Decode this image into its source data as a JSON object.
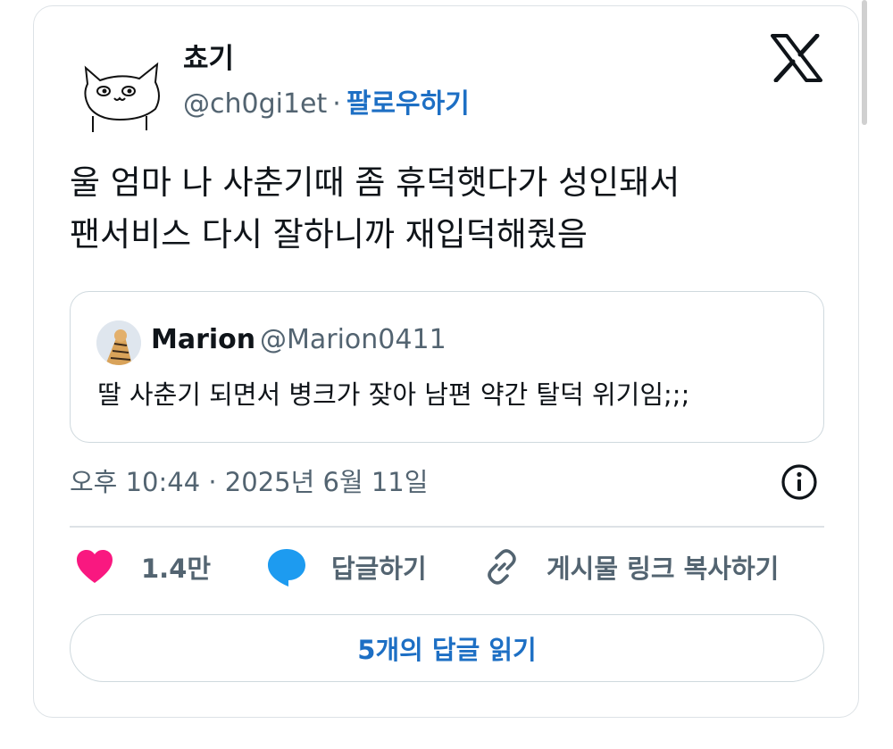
{
  "author": {
    "name": "쵸기",
    "handle": "@ch0gi1et",
    "separator": "·",
    "follow_label": "팔로우하기"
  },
  "tweet": {
    "text": "울 엄마 나 사춘기때 좀 휴덕햇다가 성인돼서\n팬서비스 다시 잘하니까 재입덕해줬음"
  },
  "quoted_tweet": {
    "name": "Marion",
    "handle": "@Marion0411",
    "text": "딸 사춘기 되면서 병크가 잦아 남편 약간 탈덕 위기임;;;"
  },
  "meta": {
    "timestamp": "오후 10:44 · 2025년 6월 11일"
  },
  "actions": {
    "like_count": "1.4만",
    "reply_label": "답글하기",
    "copy_link_label": "게시물 링크 복사하기"
  },
  "read_replies_label": "5개의 답글 읽기",
  "icons": {
    "logo": "x-logo-icon",
    "info": "info-icon",
    "like": "heart-icon",
    "reply": "speech-bubble-icon",
    "link": "link-icon"
  },
  "colors": {
    "like": "#f91880",
    "reply": "#1d9bf0",
    "accent_link": "#1d6fc4",
    "secondary_text": "#536471"
  }
}
